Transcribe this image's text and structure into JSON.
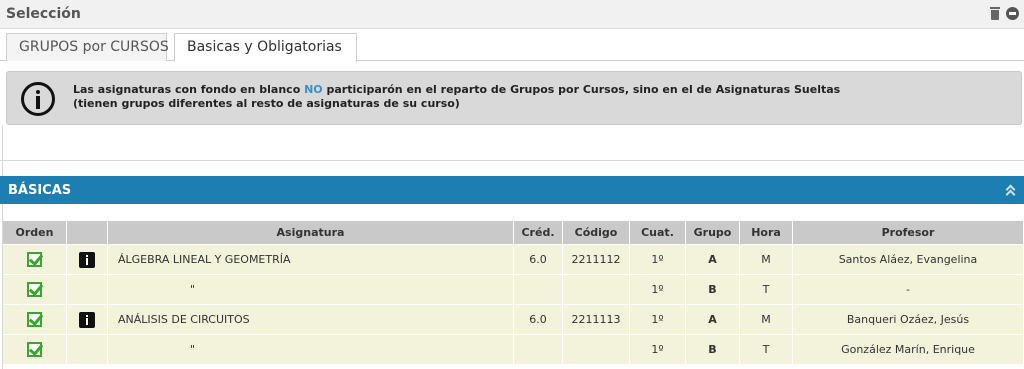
{
  "header": {
    "title": "Selección"
  },
  "tabs": [
    {
      "label": "GRUPOS por CURSOS",
      "active": false
    },
    {
      "label": "Basicas y Obligatorias",
      "active": true
    }
  ],
  "notice": {
    "line1_pre": "Las asignaturas con fondo en blanco ",
    "line1_highlight": "NO",
    "line1_post": " participarón en el reparto de Grupos por Cursos, sino en el de Asignaturas Sueltas",
    "line2": "(tienen grupos diferentes al resto de asignaturas de su curso)"
  },
  "section": {
    "title": "BÁSICAS"
  },
  "table": {
    "headers": [
      "Orden",
      "",
      "Asignatura",
      "Créd.",
      "Código",
      "Cuat.",
      "Grupo",
      "Hora",
      "Profesor"
    ],
    "rows": [
      {
        "asignatura": "ÁLGEBRA LINEAL Y GEOMETRÍA",
        "cred": "6.0",
        "codigo": "2211112",
        "cuat": "1º",
        "grupo": "A",
        "hora": "M",
        "profesor": "Santos Aláez, Evangelina"
      },
      {
        "asignatura": "\"",
        "cred": "",
        "codigo": "",
        "cuat": "1º",
        "grupo": "B",
        "hora": "T",
        "profesor": "-"
      },
      {
        "asignatura": "ANÁLISIS DE CIRCUITOS",
        "cred": "6.0",
        "codigo": "2211113",
        "cuat": "1º",
        "grupo": "A",
        "hora": "M",
        "profesor": "Banqueri Ozáez, Jesús"
      },
      {
        "asignatura": "\"",
        "cred": "",
        "codigo": "",
        "cuat": "1º",
        "grupo": "B",
        "hora": "T",
        "profesor": "González Marín, Enrique"
      }
    ]
  },
  "colors": {
    "section_bg": "#1d7fb1",
    "row_bg": "#f3f3dc",
    "highlight": "#3a8fd0",
    "check": "#3aa52f"
  }
}
